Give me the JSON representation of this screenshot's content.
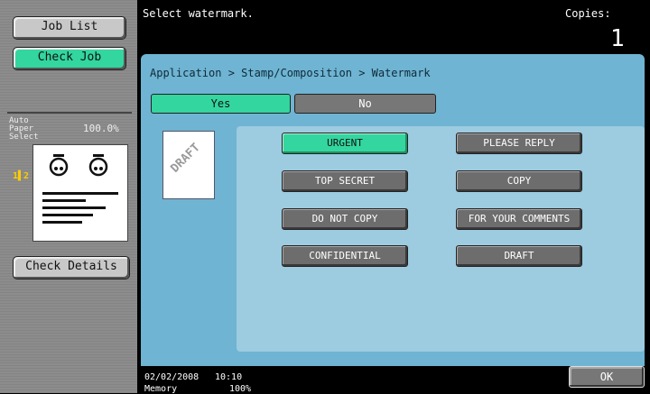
{
  "left": {
    "job_list": "Job List",
    "check_job": "Check Job",
    "auto_paper": "Auto Paper\nSelect",
    "zoom": "100.0%",
    "check_details": "Check Details"
  },
  "header": {
    "message": "Select watermark.",
    "copies_label": "Copies:",
    "copies_value": "1"
  },
  "breadcrumb": "Application > Stamp/Composition > Watermark",
  "toggle": {
    "yes": "Yes",
    "no": "No",
    "selected": "Yes"
  },
  "preview_text": "DRAFT",
  "watermarks": [
    "URGENT",
    "PLEASE REPLY",
    "TOP SECRET",
    "COPY",
    "DO NOT COPY",
    "FOR YOUR COMMENTS",
    "CONFIDENTIAL",
    "DRAFT"
  ],
  "selected_watermark": "URGENT",
  "footer": {
    "date": "02/02/2008",
    "time": "10:10",
    "memory_label": "Memory",
    "memory_value": "100%"
  },
  "ok": "OK",
  "colors": {
    "accent": "#33d69f",
    "panel": "#6fb4d2",
    "button": "#6d6d6d"
  }
}
